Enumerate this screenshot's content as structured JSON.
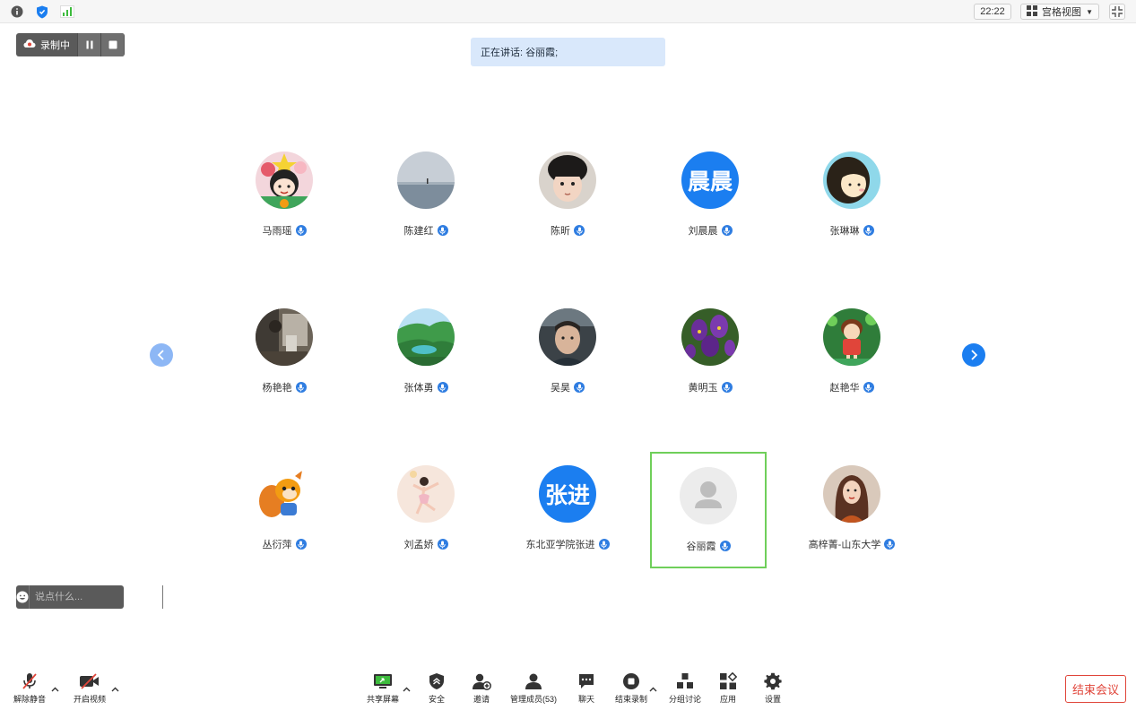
{
  "topbar": {
    "time": "22:22",
    "view_label": "宫格视图"
  },
  "recording": {
    "label": "录制中"
  },
  "speaking": {
    "text": "正在讲话: 谷丽霞;"
  },
  "participants": [
    {
      "name": "马雨瑶",
      "avatar": "cartoon-girl-photo"
    },
    {
      "name": "陈建红",
      "avatar": "sea-photo"
    },
    {
      "name": "陈昕",
      "avatar": "child-photo"
    },
    {
      "name": "刘晨晨",
      "avatar_text": "晨晨"
    },
    {
      "name": "张琳琳",
      "avatar": "cartoon-photo"
    },
    {
      "name": "杨艳艳",
      "avatar": "room-photo"
    },
    {
      "name": "张体勇",
      "avatar": "landscape-photo"
    },
    {
      "name": "吴昊",
      "avatar": "man-photo"
    },
    {
      "name": "黄明玉",
      "avatar": "iris-flowers-photo"
    },
    {
      "name": "赵艳华",
      "avatar": "cartoon-girl2-photo"
    },
    {
      "name": "丛衍萍",
      "avatar": "squirrel-photo"
    },
    {
      "name": "刘孟娇",
      "avatar": "dancer-photo"
    },
    {
      "name": "东北亚学院张进",
      "avatar_text": "张进"
    },
    {
      "name": "谷丽霞",
      "avatar": "default-user-icon"
    },
    {
      "name": "高梓菁-山东大学",
      "avatar": "woman-photo"
    }
  ],
  "chat": {
    "placeholder": "说点什么..."
  },
  "toolbar": {
    "unmute": "解除静音",
    "start_video": "开启视频",
    "share_screen": "共享屏幕",
    "security": "安全",
    "invite": "邀请",
    "manage_members": "管理成员(53)",
    "chat": "聊天",
    "end_recording": "结束录制",
    "breakout": "分组讨论",
    "apps": "应用",
    "settings": "设置",
    "end_meeting": "结束会议"
  },
  "colors": {
    "accent": "#1b7ef0",
    "active_border": "#6fcf5a",
    "danger": "#e0453a",
    "speaking_bg": "#d9e8fb"
  }
}
